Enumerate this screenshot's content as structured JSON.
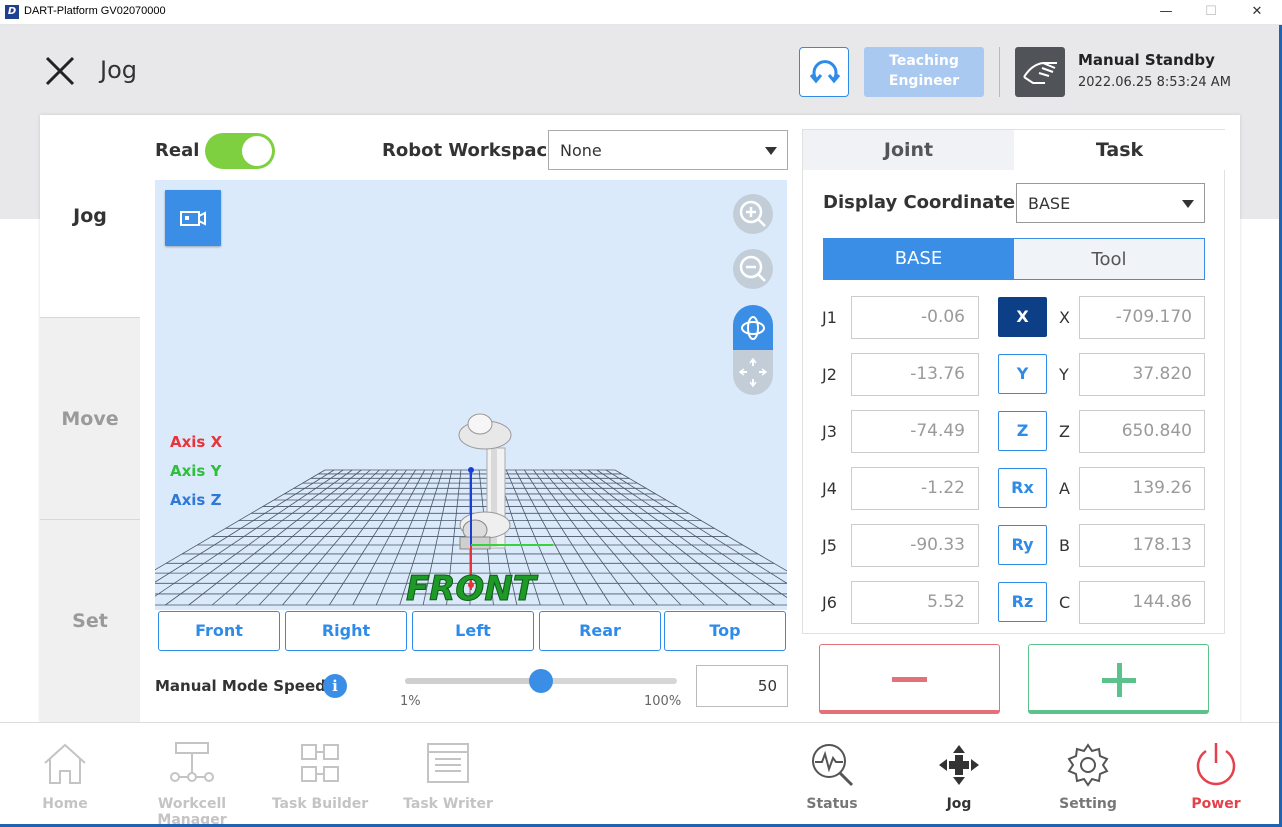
{
  "window": {
    "title": "DART-Platform GV02070000",
    "minimize": "—",
    "maximize": "☐",
    "close": "✕"
  },
  "header": {
    "title": "Jog",
    "teaching_line1": "Teaching",
    "teaching_line2": "Engineer",
    "status_title": "Manual Standby",
    "status_time": "2022.06.25 8:53:24 AM"
  },
  "sidenav": {
    "items": [
      {
        "label": "Jog",
        "active": true
      },
      {
        "label": "Move",
        "active": false
      },
      {
        "label": "Set",
        "active": false
      }
    ]
  },
  "controls": {
    "real_label": "Real",
    "real_on": true,
    "workspace_label": "Robot Workspace",
    "workspace_value": "None"
  },
  "viewport": {
    "axis_x": "Axis X",
    "axis_y": "Axis Y",
    "axis_z": "Axis Z",
    "floor_text": "FRONT",
    "colors": {
      "axis_x": "#e8333a",
      "axis_y": "#2fbf3a",
      "axis_z": "#2e78d6",
      "floor_text": "#1e9a26"
    }
  },
  "view_buttons": [
    "Front",
    "Right",
    "Left",
    "Rear",
    "Top"
  ],
  "speed": {
    "label": "Manual Mode Speed",
    "info": "i",
    "min_label": "1%",
    "max_label": "100%",
    "value": "50",
    "fraction": 0.5
  },
  "panel": {
    "tabs": [
      "Joint",
      "Task"
    ],
    "active_tab": "Task",
    "display_label": "Display Coordinates",
    "display_value": "BASE",
    "segments": [
      "BASE",
      "Tool"
    ],
    "active_segment": "BASE",
    "rows": [
      {
        "joint": "J1",
        "joint_value": "-0.06",
        "button": "X",
        "coord": "X",
        "coord_value": "-709.170",
        "selected": true
      },
      {
        "joint": "J2",
        "joint_value": "-13.76",
        "button": "Y",
        "coord": "Y",
        "coord_value": "37.820",
        "selected": false
      },
      {
        "joint": "J3",
        "joint_value": "-74.49",
        "button": "Z",
        "coord": "Z",
        "coord_value": "650.840",
        "selected": false
      },
      {
        "joint": "J4",
        "joint_value": "-1.22",
        "button": "Rx",
        "coord": "A",
        "coord_value": "139.26",
        "selected": false
      },
      {
        "joint": "J5",
        "joint_value": "-90.33",
        "button": "Ry",
        "coord": "B",
        "coord_value": "178.13",
        "selected": false
      },
      {
        "joint": "J6",
        "joint_value": "5.52",
        "button": "Rz",
        "coord": "C",
        "coord_value": "144.86",
        "selected": false
      }
    ]
  },
  "bottom_nav": [
    {
      "label": "Home",
      "state": "disabled"
    },
    {
      "label": "Workcell Manager",
      "state": "disabled"
    },
    {
      "label": "Task Builder",
      "state": "disabled"
    },
    {
      "label": "Task Writer",
      "state": "disabled"
    },
    {
      "label": "Status",
      "state": "enabled"
    },
    {
      "label": "Jog",
      "state": "active"
    },
    {
      "label": "Setting",
      "state": "enabled"
    },
    {
      "label": "Power",
      "state": "power"
    }
  ]
}
